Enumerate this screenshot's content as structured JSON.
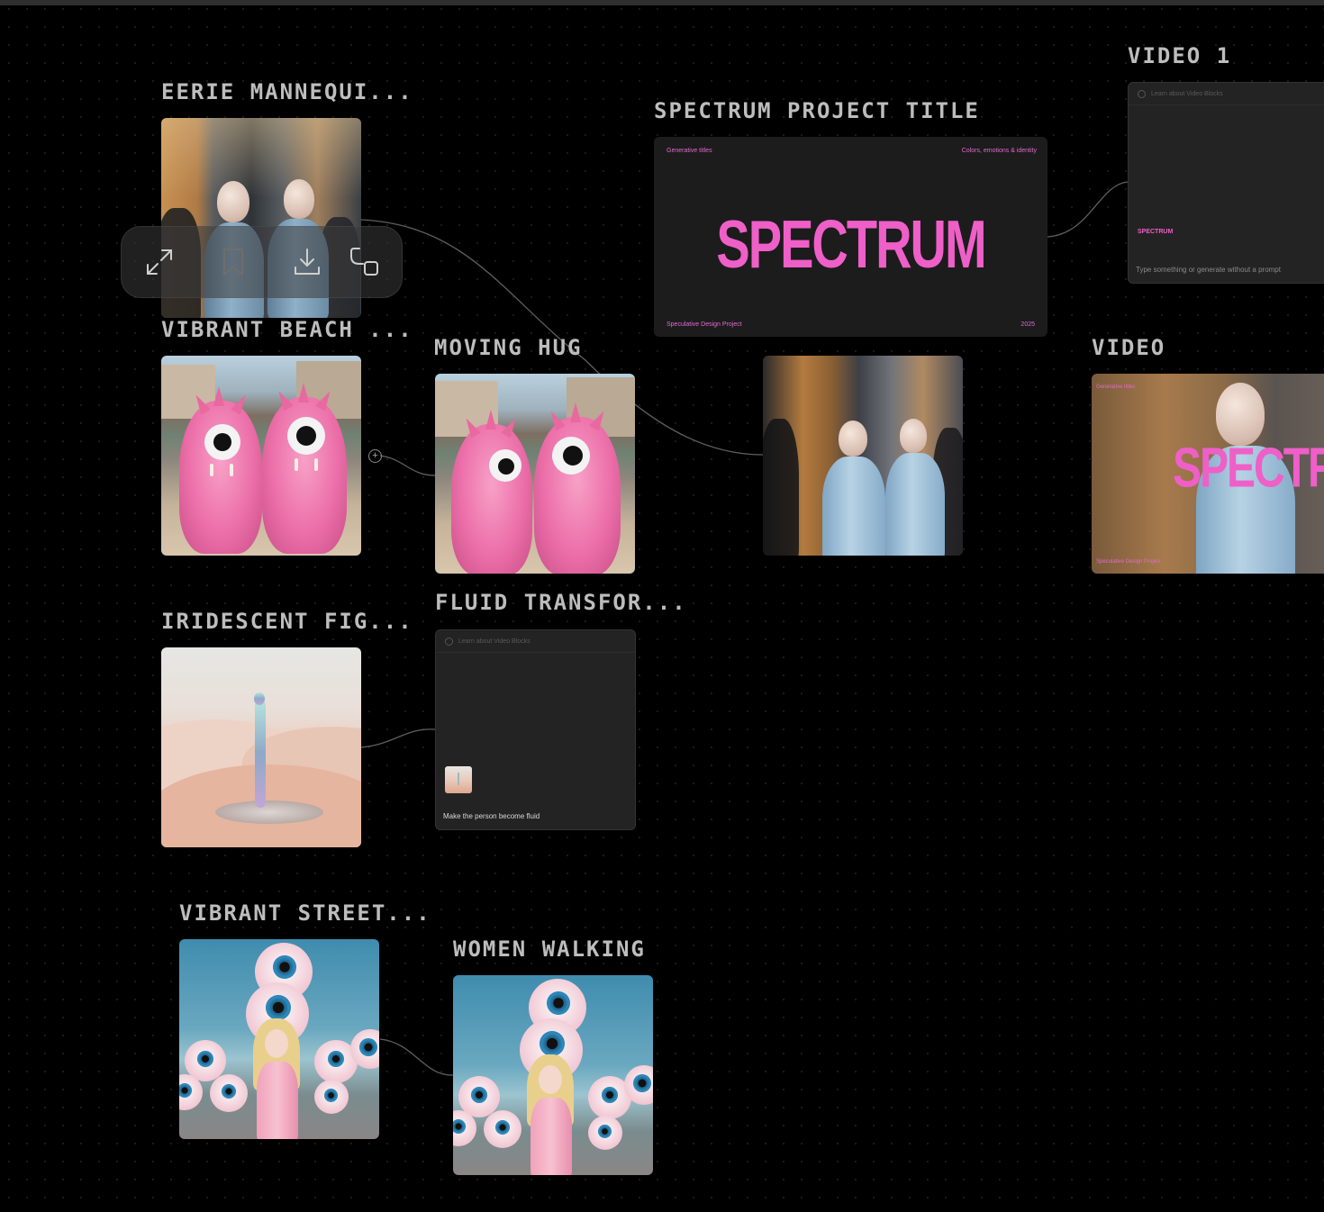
{
  "canvas": {
    "nodes": [
      {
        "id": "eerie",
        "label": "EERIE MANNEQUI...",
        "kind": "image",
        "subject": "two bald mannequin-like figures in denim shirts on a city street"
      },
      {
        "id": "vibrant_beach",
        "label": "VIBRANT BEACH ...",
        "kind": "image",
        "subject": "two pink furry one-eyed monsters on a busy beach"
      },
      {
        "id": "moving_hug",
        "label": "MOVING HUG",
        "kind": "video",
        "subject": "two pink furry one-eyed monsters"
      },
      {
        "id": "spectrum_title",
        "label": "SPECTRUM PROJECT TITLE",
        "kind": "slide"
      },
      {
        "id": "street_people",
        "label": "",
        "kind": "image",
        "subject": "two bald figures walking among a crowd"
      },
      {
        "id": "video_1",
        "label": "VIDEO 1",
        "kind": "video-block"
      },
      {
        "id": "video",
        "label": "VIDEO",
        "kind": "video",
        "subject": "SPECTRUM title over bald figure"
      },
      {
        "id": "iridescent",
        "label": "IRIDESCENT FIG...",
        "kind": "image",
        "subject": "iridescent figure standing in pink desert"
      },
      {
        "id": "fluid",
        "label": "FLUID TRANSFOR...",
        "kind": "video-block"
      },
      {
        "id": "vibrant_street",
        "label": "VIBRANT STREET...",
        "kind": "image",
        "subject": "blonde woman in pink suit among giant eyeballs"
      },
      {
        "id": "women_walking",
        "label": "WOMEN WALKING",
        "kind": "video",
        "subject": "blonde woman in pink suit among giant eyeballs"
      }
    ]
  },
  "spectrum_slide": {
    "top_left": "Generative titles",
    "top_right": "Colors, emotions & identity",
    "title": "SPECTRUM",
    "bottom_left": "Speculative Design Project",
    "bottom_right": "2025"
  },
  "video_slide": {
    "top_left": "Generative titles",
    "title": "SPECTRU",
    "bottom_left": "Speculative Design Project"
  },
  "video1_block": {
    "header": "Learn about Video Blocks",
    "thumb_text": "SPECTRUM",
    "prompt": "Type something or generate without a prompt"
  },
  "fluid_block": {
    "header": "Learn about Video Blocks",
    "prompt": "Make the person become fluid"
  },
  "toolbar": {
    "buttons": [
      "expand-icon",
      "bookmark-icon",
      "download-icon",
      "duplicate-icon"
    ]
  },
  "colors": {
    "background": "#000000",
    "label": "#bdbdbd",
    "accent_pink": "#ef5fc8",
    "panel": "#1c1c1c"
  }
}
